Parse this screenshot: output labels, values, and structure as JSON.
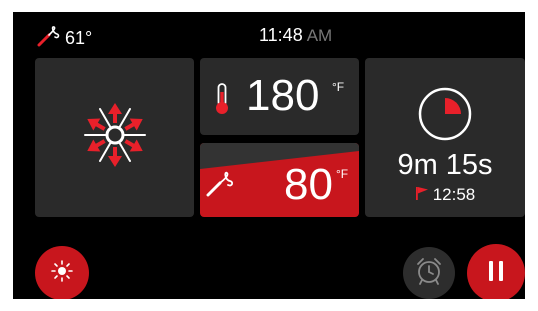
{
  "status_bar": {
    "probe_temp": "61°",
    "time": "11:48",
    "ampm": "AM"
  },
  "oven": {
    "temperature": "180",
    "unit": "°F"
  },
  "probe": {
    "temperature": "80",
    "unit": "°F"
  },
  "timer": {
    "remaining": "9m 15s",
    "done_time": "12:58",
    "progress_fraction": 0.25
  },
  "mode": {
    "icon": "convection-fan-icon"
  },
  "controls": {
    "light_icon": "light-icon",
    "alarm_icon": "alarm-clock-icon",
    "pause_icon": "pause-icon"
  },
  "colors": {
    "accent": "#c8161d",
    "tile": "#2a2a2a",
    "background": "#000000"
  }
}
